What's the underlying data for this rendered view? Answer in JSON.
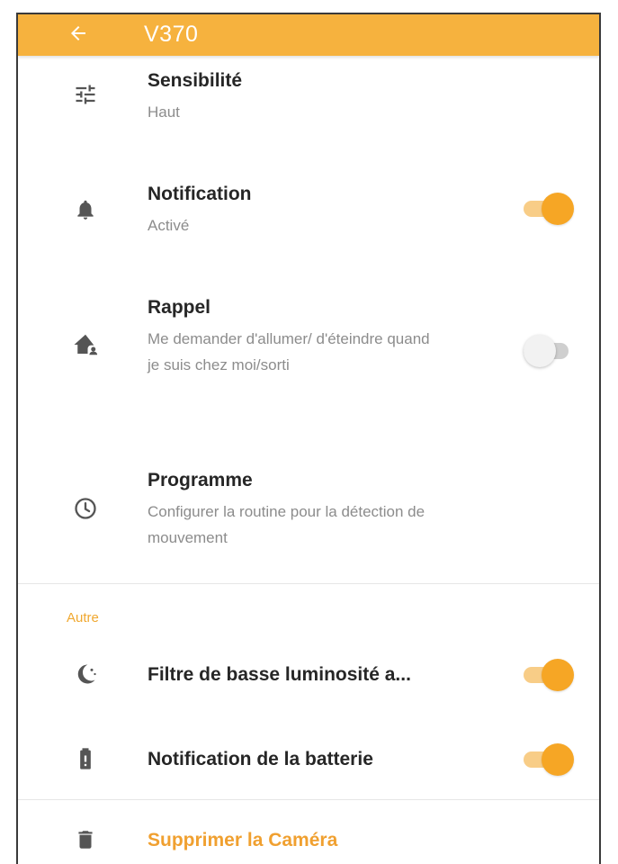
{
  "header": {
    "back_icon": "arrow-left-icon",
    "title": "V370",
    "color": "#f6b23e"
  },
  "settings": {
    "sensitivity": {
      "icon": "tune-sliders-icon",
      "title": "Sensibilité",
      "value": "Haut"
    },
    "notification": {
      "icon": "bell-icon",
      "title": "Notification",
      "value": "Activé",
      "enabled": true
    },
    "reminder": {
      "icon": "home-person-icon",
      "title": "Rappel",
      "description": "Me demander d'allumer/ d'éteindre quand je suis chez moi/sorti",
      "enabled": false
    },
    "schedule": {
      "icon": "clock-icon",
      "title": "Programme",
      "description": "Configurer la routine pour la détection de mouvement"
    }
  },
  "other_section": {
    "label": "Autre",
    "low_light_filter": {
      "icon": "moon-icon",
      "title": "Filtre de basse luminosité a...",
      "enabled": true
    },
    "battery_notification": {
      "icon": "battery-icon",
      "title": "Notification de la batterie",
      "enabled": true
    },
    "delete_camera": {
      "icon": "trash-icon",
      "title": "Supprimer la Caméra"
    }
  },
  "colors": {
    "accent": "#f6a625",
    "toggle_track_on": "#f8cd87",
    "toggle_off": "#cfcfcf",
    "section_label": "#f0a830"
  }
}
